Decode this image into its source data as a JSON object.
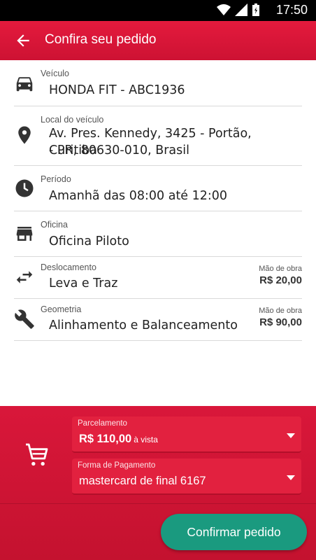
{
  "status_bar": {
    "time": "17:50"
  },
  "app_bar": {
    "title": "Confira seu pedido"
  },
  "rows": [
    {
      "label": "Veículo",
      "value": "HONDA FIT - ABC1936",
      "icon": "car-icon"
    },
    {
      "label": "Local do veículo",
      "value_line1": "Av. Pres. Kennedy, 3425 - Portão, Curitiba",
      "value_line2": "- PR, 80630-010, Brasil",
      "icon": "location-pin-icon"
    },
    {
      "label": "Período",
      "value": "Amanhã das 08:00 até 12:00",
      "icon": "clock-icon"
    },
    {
      "label": "Oficina",
      "value": "Oficina Piloto",
      "icon": "store-icon"
    },
    {
      "label": "Deslocamento",
      "value": "Leva e Traz",
      "price_label": "Mão de obra",
      "price": "R$ 20,00",
      "icon": "swap-arrows-icon"
    },
    {
      "label": "Geometria",
      "value": "Alinhamento e Balanceamento",
      "price_label": "Mão de obra",
      "price": "R$ 90,00",
      "icon": "wrench-icon"
    }
  ],
  "payment": {
    "installments_label": "Parcelamento",
    "installments_value": "R$ 110,00",
    "installments_suffix": "à vista",
    "method_label": "Forma de Pagamento",
    "method_value": "mastercard de final 6167"
  },
  "confirm_label": "Confirmar pedido",
  "colors": {
    "primary": "#e41a3d",
    "accent": "#1a9a7f"
  }
}
